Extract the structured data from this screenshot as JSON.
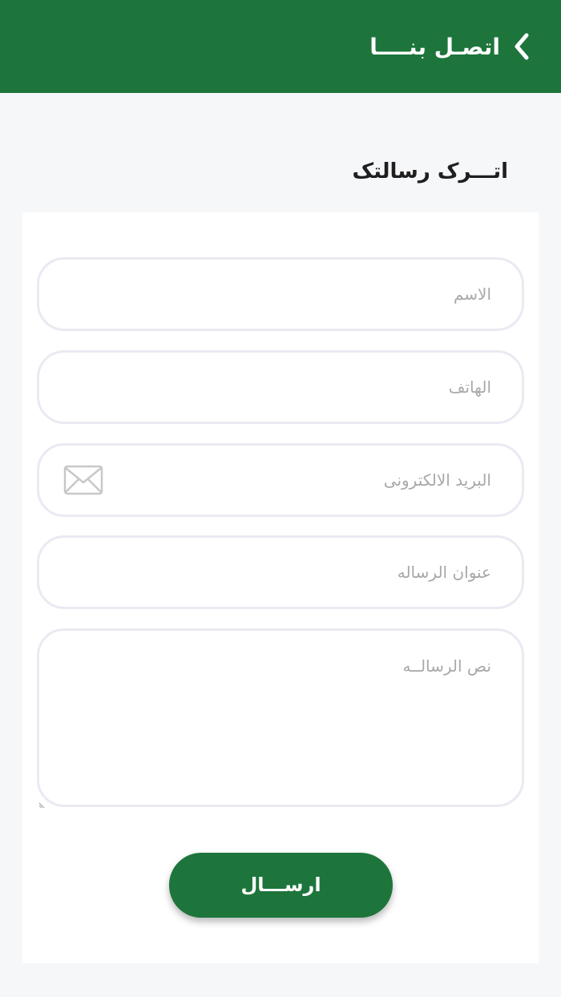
{
  "header": {
    "title": "اتصـل  بنــــا",
    "back_icon": "chevron-left-icon",
    "background_color": "#1d753c"
  },
  "section": {
    "title": "اتـــرک  رسالتک"
  },
  "form": {
    "name_placeholder": "الاسم",
    "phone_placeholder": "الهاتف",
    "email_placeholder": "البريد الالكترونى",
    "email_icon": "mail-icon",
    "subject_placeholder": "عنوان الرساله",
    "message_placeholder": "نص الرسالــه",
    "submit_label": "ارســـال"
  },
  "colors": {
    "accent": "#1d753c",
    "page_background": "#f6f7f9",
    "field_border": "#e9eaf2"
  }
}
